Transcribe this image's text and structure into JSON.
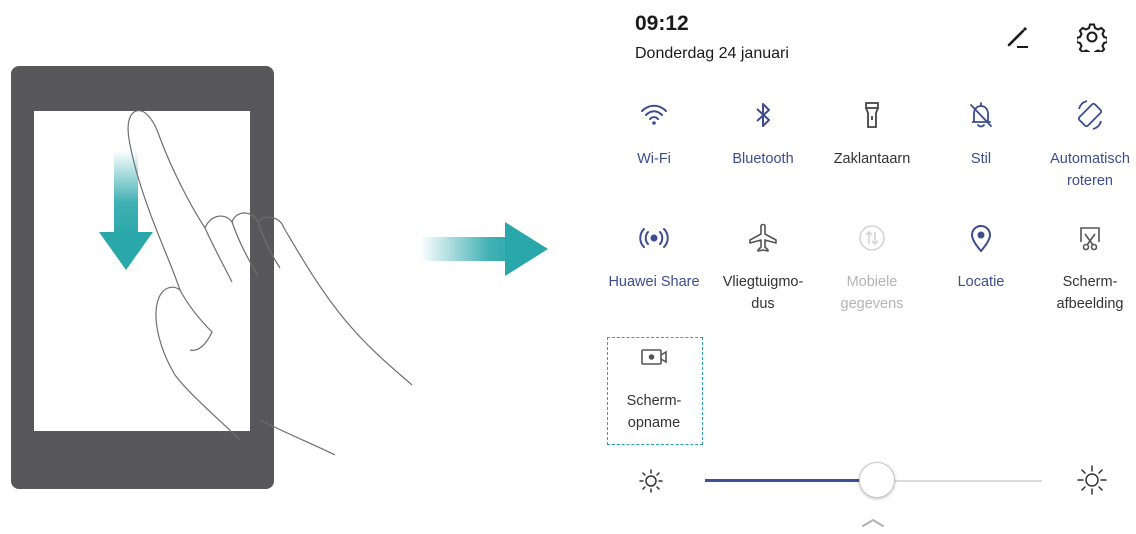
{
  "status": {
    "time": "09:12",
    "date": "Donderdag 24 januari"
  },
  "header_icons": [
    {
      "name": "edit-icon"
    },
    {
      "name": "settings-gear-icon"
    }
  ],
  "tiles": [
    {
      "id": "wifi",
      "icon": "wifi-icon",
      "lines": [
        "Wi-Fi"
      ],
      "state": "on"
    },
    {
      "id": "bluetooth",
      "icon": "bluetooth-icon",
      "lines": [
        "Bluetooth"
      ],
      "state": "on"
    },
    {
      "id": "flashlight",
      "icon": "flashlight-icon",
      "lines": [
        "Zaklantaarn"
      ],
      "state": "off"
    },
    {
      "id": "silent",
      "icon": "bell-off-icon",
      "lines": [
        "Stil"
      ],
      "state": "on"
    },
    {
      "id": "autorotate",
      "icon": "rotate-icon",
      "lines": [
        "Automatisch",
        "roteren"
      ],
      "state": "on"
    },
    {
      "id": "huawei-share",
      "icon": "huawei-share-icon",
      "lines": [
        "Huawei Share"
      ],
      "state": "on"
    },
    {
      "id": "airplane",
      "icon": "airplane-icon",
      "lines": [
        "Vliegtuigmo-",
        "dus"
      ],
      "state": "off"
    },
    {
      "id": "mobile-data",
      "icon": "mobile-data-icon",
      "lines": [
        "Mobiele",
        "gegevens"
      ],
      "state": "disabled"
    },
    {
      "id": "location",
      "icon": "location-pin-icon",
      "lines": [
        "Locatie"
      ],
      "state": "on"
    },
    {
      "id": "screenshot",
      "icon": "screenshot-icon",
      "lines": [
        "Scherm-",
        "afbeelding"
      ],
      "state": "off"
    },
    {
      "id": "screen-record",
      "icon": "screen-record-icon",
      "lines": [
        "Scherm-",
        "opname"
      ],
      "state": "off"
    }
  ],
  "brightness": {
    "value": 0.51
  },
  "colors": {
    "accent": "#3d4d8f",
    "highlight": "#27a6ae",
    "arrow": "#2aa7ab"
  }
}
